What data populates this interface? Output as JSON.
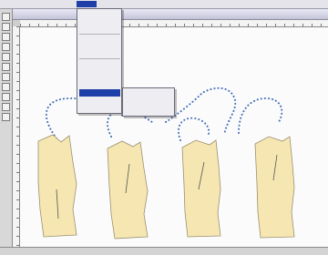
{
  "menubar": {
    "items": [
      "",
      "",
      "",
      "",
      "",
      "",
      ""
    ]
  },
  "window": {
    "title": ""
  },
  "menu": {
    "items": [
      "",
      "",
      "",
      "",
      "",
      "",
      "",
      "",
      "",
      "",
      "",
      ""
    ],
    "selected_index": 10
  },
  "submenu": {
    "items": [
      "",
      "",
      "",
      ""
    ]
  },
  "colors": {
    "accent": "#1e3fa8",
    "pattern_fill": "#f6e7b2",
    "dots": "#3f6db8"
  },
  "icons": {
    "tools": "tool-icon",
    "submenu_arrow": "triangle-right-icon"
  }
}
